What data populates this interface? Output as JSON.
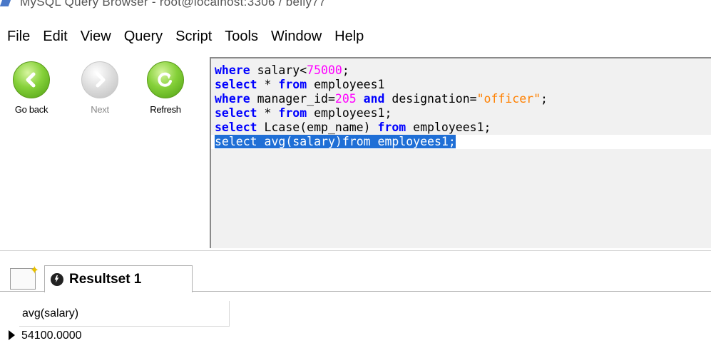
{
  "window": {
    "title": "MySQL Query Browser - root@localhost:3306 / belly77"
  },
  "menu": [
    "File",
    "Edit",
    "View",
    "Query",
    "Script",
    "Tools",
    "Window",
    "Help"
  ],
  "toolbar": {
    "back_label": "Go back",
    "next_label": "Next",
    "refresh_label": "Refresh"
  },
  "editor": {
    "lines": [
      [
        {
          "t": "where",
          "c": "kw"
        },
        {
          "t": " salary<"
        },
        {
          "t": "75000",
          "c": "num"
        },
        {
          "t": ";"
        }
      ],
      [
        {
          "t": "select",
          "c": "kw"
        },
        {
          "t": " * "
        },
        {
          "t": "from",
          "c": "kw"
        },
        {
          "t": " employees1"
        }
      ],
      [
        {
          "t": "where",
          "c": "kw"
        },
        {
          "t": " manager_id="
        },
        {
          "t": "205",
          "c": "num"
        },
        {
          "t": " "
        },
        {
          "t": "and",
          "c": "kw"
        },
        {
          "t": " designation="
        },
        {
          "t": "\"officer\"",
          "c": "str"
        },
        {
          "t": ";"
        }
      ],
      [
        {
          "t": "select",
          "c": "kw"
        },
        {
          "t": " * "
        },
        {
          "t": "from",
          "c": "kw"
        },
        {
          "t": " employees1;"
        }
      ],
      [
        {
          "t": "select",
          "c": "kw"
        },
        {
          "t": " Lcase(emp_name) "
        },
        {
          "t": "from",
          "c": "kw"
        },
        {
          "t": " employees1;"
        }
      ],
      [
        {
          "t": "select",
          "c": "sel"
        },
        {
          "t": " avg(salary)",
          "c": "sel"
        },
        {
          "t": "from",
          "c": "sel"
        },
        {
          "t": " employees1;",
          "c": "sel"
        }
      ]
    ]
  },
  "results": {
    "tab_label": "Resultset 1",
    "columns": [
      "avg(salary)"
    ],
    "rows": [
      [
        "54100.0000"
      ]
    ]
  }
}
